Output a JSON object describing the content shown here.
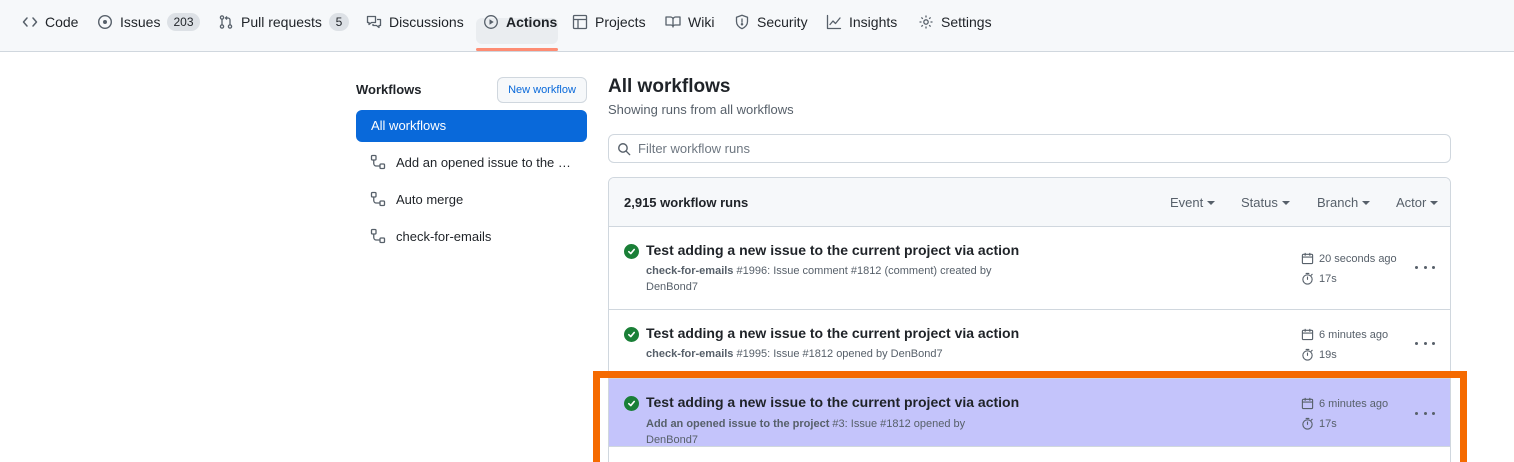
{
  "nav": {
    "items": [
      {
        "label": "Code",
        "icon": "code-icon"
      },
      {
        "label": "Issues",
        "icon": "issue-opened-icon",
        "count": "203"
      },
      {
        "label": "Pull requests",
        "icon": "git-pull-request-icon",
        "count": "5"
      },
      {
        "label": "Discussions",
        "icon": "comment-discussion-icon"
      },
      {
        "label": "Actions",
        "icon": "play-icon",
        "selected": true
      },
      {
        "label": "Projects",
        "icon": "table-icon"
      },
      {
        "label": "Wiki",
        "icon": "book-icon"
      },
      {
        "label": "Security",
        "icon": "shield-icon"
      },
      {
        "label": "Insights",
        "icon": "graph-icon"
      },
      {
        "label": "Settings",
        "icon": "gear-icon"
      }
    ]
  },
  "sidebar": {
    "title": "Workflows",
    "new_workflow_label": "New workflow",
    "active_label": "All workflows",
    "workflows": [
      {
        "label": "Add an opened issue to the project",
        "icon": "workflow-icon"
      },
      {
        "label": "Auto merge",
        "icon": "workflow-icon"
      },
      {
        "label": "check-for-emails",
        "icon": "workflow-icon"
      }
    ]
  },
  "main": {
    "title": "All workflows",
    "subtitle": "Showing runs from all workflows",
    "filter_placeholder": "Filter workflow runs",
    "runs_count": "2,915 workflow runs",
    "filters": [
      "Event",
      "Status",
      "Branch",
      "Actor"
    ],
    "runs": [
      {
        "title": "Test adding a new issue to the current project via action",
        "workflow": "check-for-emails",
        "detail": "#1996: Issue comment #1812 (comment) created by",
        "detail2": "DenBond7",
        "when": "20 seconds ago",
        "duration": "17s",
        "status": "success"
      },
      {
        "title": "Test adding a new issue to the current project via action",
        "workflow": "check-for-emails",
        "detail": "#1995: Issue #1812 opened by DenBond7",
        "detail2": "",
        "when": "6 minutes ago",
        "duration": "19s",
        "status": "success"
      },
      {
        "title": "Test adding a new issue to the current project via action",
        "workflow": "Add an opened issue to the project",
        "detail": "#3: Issue #1812 opened by DenBond7",
        "detail2": "",
        "when": "6 minutes ago",
        "duration": "17s",
        "status": "success",
        "highlighted": true
      }
    ]
  },
  "colors": {
    "accent": "#0969da",
    "success": "#1a7f37",
    "nav_underline": "#fd8c73",
    "highlight_fill": "#c4c4fb",
    "highlight_border": "#f56a00"
  }
}
